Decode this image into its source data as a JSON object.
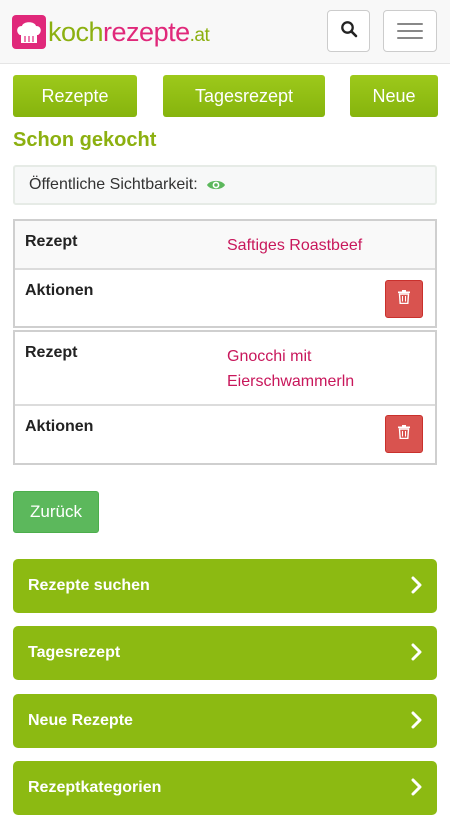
{
  "header": {
    "logo_koch": "koch",
    "logo_rezepte": "rezepte",
    "logo_at": ".at",
    "search_icon": "search-icon",
    "menu_icon": "hamburger-menu-icon"
  },
  "tabs": [
    {
      "label": "Rezepte"
    },
    {
      "label": "Tagesrezept"
    },
    {
      "label": "Neue"
    }
  ],
  "section_title": "Schon gekocht",
  "visibility": {
    "label": "Öffentliche Sichtbarkeit:",
    "icon": "eye-icon"
  },
  "entries": [
    {
      "rezept_label": "Rezept",
      "recipe": "Saftiges Roastbeef",
      "aktionen_label": "Aktionen",
      "delete_icon": "trash-icon"
    },
    {
      "rezept_label": "Rezept",
      "recipe_line1": "Gnocchi mit",
      "recipe_line2": "Eierschwammerln",
      "aktionen_label": "Aktionen",
      "delete_icon": "trash-icon"
    }
  ],
  "back_label": "Zurück",
  "nav_buttons": [
    {
      "label": "Rezepte suchen"
    },
    {
      "label": "Tagesrezept"
    },
    {
      "label": "Neue Rezepte"
    },
    {
      "label": "Rezeptkategorien"
    }
  ],
  "colors": {
    "brand_green": "#8cba12",
    "brand_pink": "#e0287a",
    "link_color": "#c8175b",
    "danger": "#d9534f",
    "success": "#5cb85c"
  }
}
